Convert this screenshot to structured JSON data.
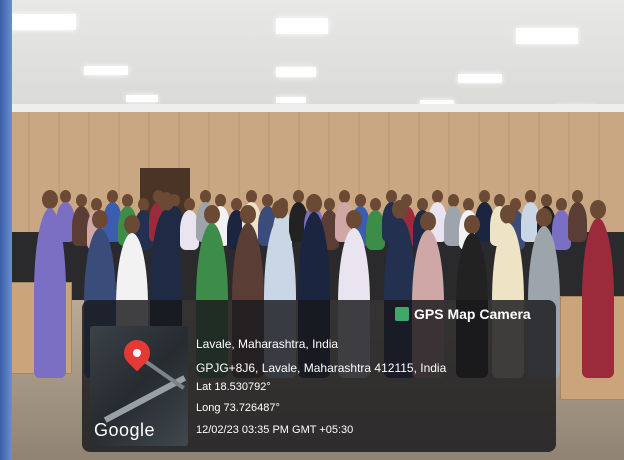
{
  "gps_overlay": {
    "app_name": "GPS Map Camera",
    "place": "Lavale, Maharashtra, India",
    "address": "GPJG+8J6, Lavale, Maharashtra 412115, India",
    "latitude": "Lat 18.530792°",
    "longitude": "Long 73.726487°",
    "datetime": "12/02/23 03:35 PM GMT +05:30",
    "map_attribution": "Google"
  }
}
